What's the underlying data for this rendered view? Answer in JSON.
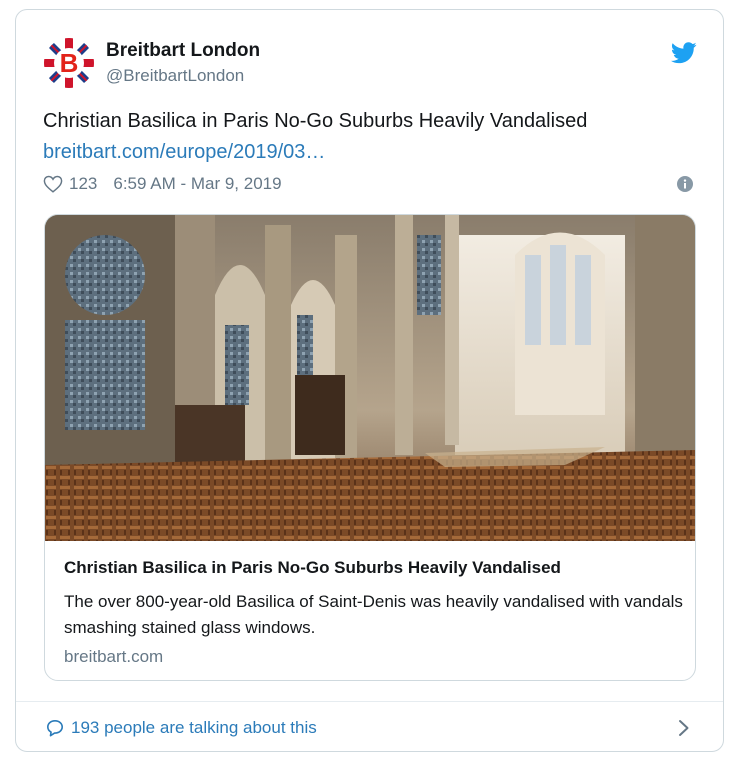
{
  "author": {
    "name": "Breitbart London",
    "handle": "@BreitbartLondon",
    "avatar_icon": "breitbart-b-union-jack-logo"
  },
  "tweet": {
    "text": "Christian Basilica in Paris No-Go Suburbs Heavily Vandalised",
    "link": "breitbart.com/europe/2019/03…",
    "likes": "123",
    "timestamp": "6:59 AM - Mar 9, 2019"
  },
  "card": {
    "image_description_icon": "cathedral-interior-photo",
    "title": "Christian Basilica in Paris No-Go Suburbs Heavily Vandalised",
    "description": "The over 800-year-old Basilica of Saint-Denis was heavily vandalised with vandals smashing stained glass windows.",
    "domain": "breitbart.com"
  },
  "footer": {
    "talking": "193 people are talking about this"
  },
  "colors": {
    "twitter_blue": "#1da1f2",
    "link_blue": "#2b7bb9",
    "text": "#14171a",
    "muted": "#657786",
    "border": "#cfd9de"
  }
}
